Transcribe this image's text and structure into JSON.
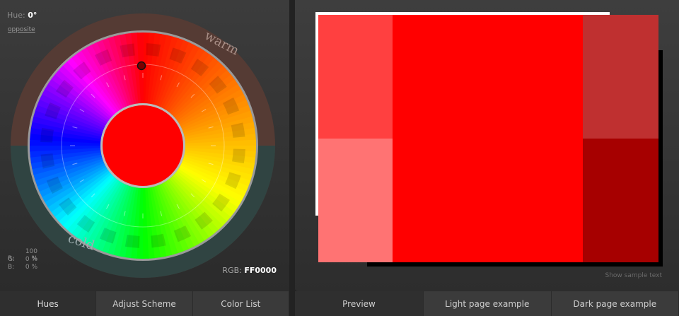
{
  "hue": {
    "label": "Hue:",
    "value": "0°"
  },
  "opposite_label": "opposite",
  "wheel": {
    "warm_label": "warm",
    "cold_label": "cold"
  },
  "rgb": {
    "r": {
      "key": "R:",
      "value": "100 %"
    },
    "g": {
      "key": "G:",
      "value": "0 %"
    },
    "b": {
      "key": "B:",
      "value": "0 %"
    },
    "hex_label": "RGB:",
    "hex_value": "FF0000"
  },
  "tabs_left": [
    "Hues",
    "Adjust Scheme",
    "Color List"
  ],
  "tabs_right": [
    "Preview",
    "Light page example",
    "Dark page example"
  ],
  "show_sample_text": "Show sample text",
  "colors": {
    "primary": "#ff0000",
    "light1": "#ff4040",
    "light2": "#ff7373",
    "dark1": "#bf3030",
    "dark2": "#a60000"
  }
}
